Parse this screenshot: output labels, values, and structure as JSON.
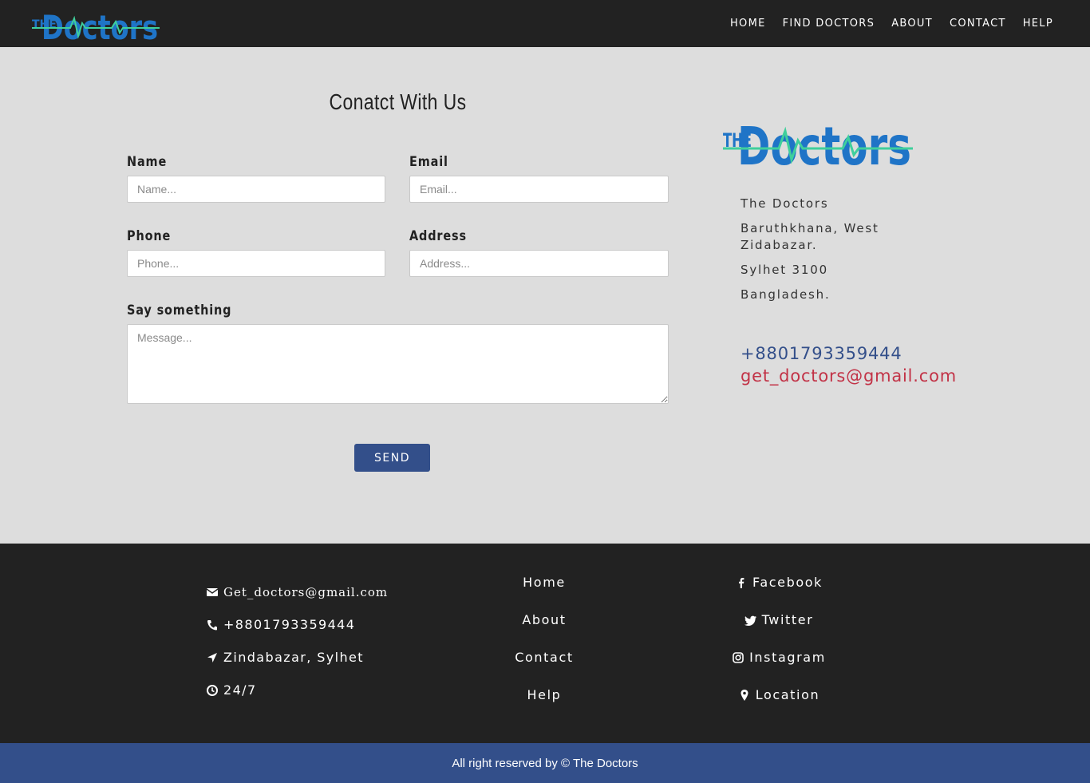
{
  "brand": {
    "logo_the": "THE",
    "logo_doctors": "Doctors",
    "colors": {
      "navbar": "#222222",
      "logo_blue": "#1f74c7",
      "logo_pulse": "#3fcf9c",
      "accent": "#334f8a",
      "email_red": "#c23347"
    }
  },
  "nav": {
    "items": [
      {
        "label": "HOME"
      },
      {
        "label": "FIND DOCTORS"
      },
      {
        "label": "ABOUT"
      },
      {
        "label": "CONTACT"
      },
      {
        "label": "HELP"
      }
    ]
  },
  "form": {
    "title": "Conatct With Us",
    "name_label": "Name",
    "name_placeholder": "Name...",
    "email_label": "Email",
    "email_placeholder": "Email...",
    "phone_label": "Phone",
    "phone_placeholder": "Phone...",
    "address_label": "Address",
    "address_placeholder": "Address...",
    "message_label": "Say something",
    "message_placeholder": "Message...",
    "send_label": "SEND"
  },
  "info": {
    "name": "The Doctors",
    "address_line1": "Baruthkhana, West Zidabazar.",
    "address_line2": "Sylhet 3100",
    "address_line3": "Bangladesh.",
    "phone": "+8801793359444",
    "email": "get_doctors@gmail.com"
  },
  "footer": {
    "contact": [
      {
        "icon": "envelope-icon",
        "text": "Get_doctors@gmail.com"
      },
      {
        "icon": "phone-icon",
        "text": "+8801793359444"
      },
      {
        "icon": "location-arrow-icon",
        "text": "Zindabazar, Sylhet"
      },
      {
        "icon": "clock-icon",
        "text": "24/7"
      }
    ],
    "links": [
      {
        "label": "Home"
      },
      {
        "label": "About"
      },
      {
        "label": "Contact"
      },
      {
        "label": "Help"
      }
    ],
    "social": [
      {
        "icon": "facebook-icon",
        "label": "Facebook"
      },
      {
        "icon": "twitter-icon",
        "label": "Twitter"
      },
      {
        "icon": "instagram-icon",
        "label": "Instagram"
      },
      {
        "icon": "map-marker-icon",
        "label": "Location"
      }
    ],
    "copyright": "All right reserved by © The Doctors"
  }
}
